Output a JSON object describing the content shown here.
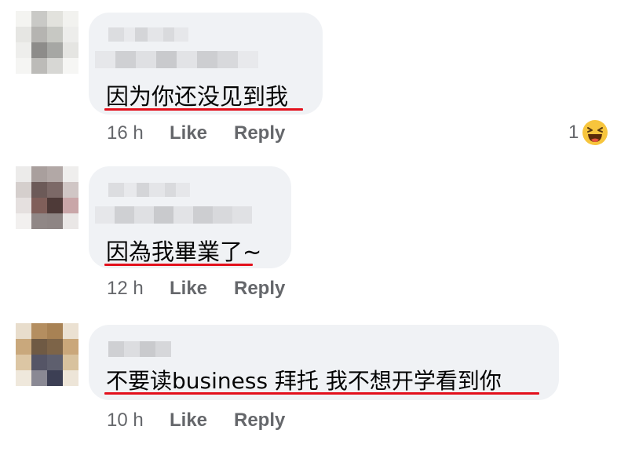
{
  "comments": [
    {
      "text": "因为你还没见到我",
      "time": "16 h",
      "like_label": "Like",
      "reply_label": "Reply",
      "reaction_count": "1",
      "reaction_icon": "laughing-emoji"
    },
    {
      "text": "因為我畢業了~",
      "time": "12 h",
      "like_label": "Like",
      "reply_label": "Reply"
    },
    {
      "text": "不要读business 拜托 我不想开学看到你",
      "time": "10 h",
      "like_label": "Like",
      "reply_label": "Reply"
    }
  ],
  "colors": {
    "bubble": "#f0f2f5",
    "underline": "#e3101c",
    "meta_text": "#65676b",
    "body_text": "#050505"
  }
}
